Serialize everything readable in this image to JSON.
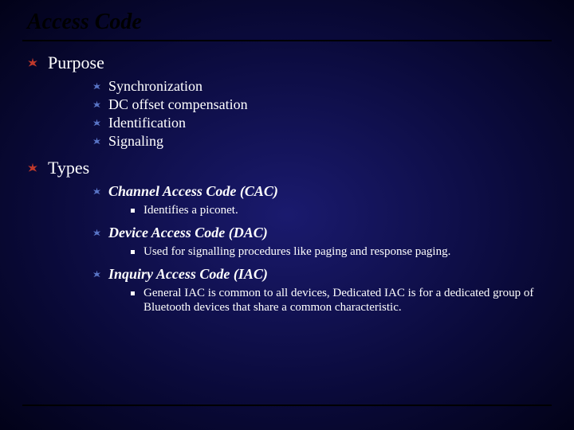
{
  "title": "Access Code",
  "sections": [
    {
      "heading": "Purpose",
      "items": [
        "Synchronization",
        "DC offset compensation",
        "Identification",
        "Signaling"
      ]
    },
    {
      "heading": "Types",
      "types": [
        {
          "name": "Channel Access Code (CAC)",
          "desc": "Identifies a piconet."
        },
        {
          "name": "Device Access Code (DAC)",
          "desc": "Used for signalling procedures like paging and response paging."
        },
        {
          "name": "Inquiry Access Code (IAC)",
          "desc": "General IAC is common to all devices, Dedicated IAC is for a dedicated group of Bluetooth devices that share a common characteristic."
        }
      ]
    }
  ]
}
